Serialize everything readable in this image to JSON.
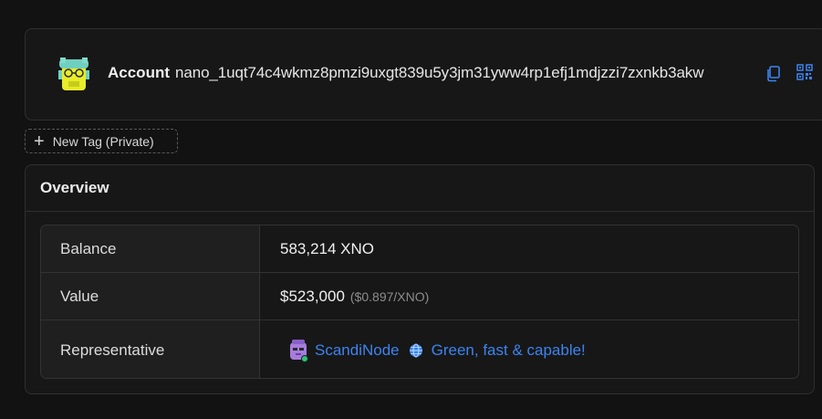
{
  "account": {
    "label": "Account",
    "address": "nano_1uqt74c4wkmz8pmzi9uxgt839u5y3jm31yww4rp1efj1mdjzzi7zxnkb3akw",
    "avatar_icon": "account-avatar-icon",
    "copy_icon": "copy-icon",
    "qr_icon": "qr-code-icon"
  },
  "tag_button": {
    "label": "New Tag (Private)",
    "icon": "plus-icon"
  },
  "overview": {
    "title": "Overview",
    "rows": {
      "balance": {
        "label": "Balance",
        "value": "583,214 XNO"
      },
      "value": {
        "label": "Value",
        "value": "$523,000",
        "sub": "($0.897/XNO)"
      },
      "representative": {
        "label": "Representative",
        "name": "ScandiNode",
        "description": "Green, fast & capable!",
        "avatar_icon": "representative-avatar-icon",
        "globe_icon": "globe-icon"
      }
    }
  },
  "colors": {
    "link": "#3d83f0",
    "background": "#121212",
    "card": "#171717"
  }
}
